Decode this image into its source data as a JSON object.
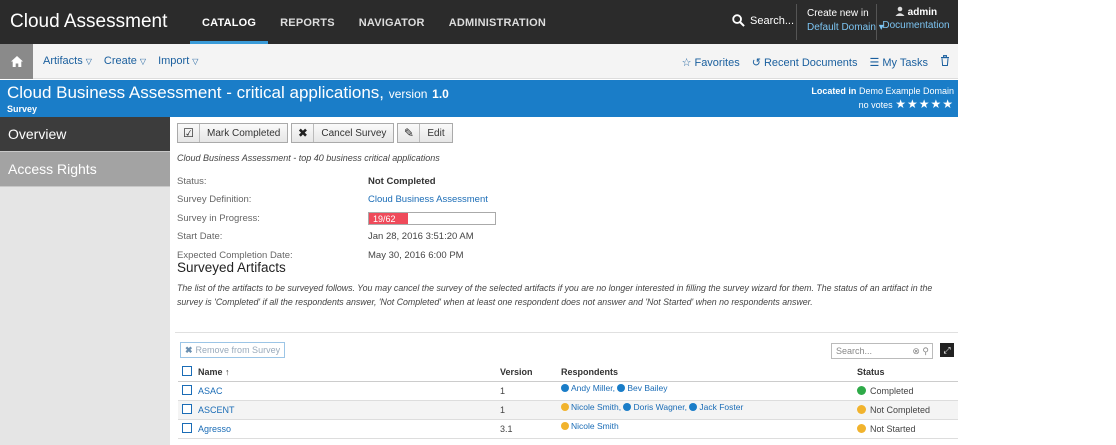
{
  "brand": "Cloud Assessment",
  "topnav": [
    {
      "label": "CATALOG",
      "active": true
    },
    {
      "label": "REPORTS",
      "active": false
    },
    {
      "label": "NAVIGATOR",
      "active": false
    },
    {
      "label": "ADMINISTRATION",
      "active": false
    }
  ],
  "top_search": "Search...",
  "create_new": {
    "label": "Create new in",
    "domain": "Default Domain"
  },
  "user": {
    "name": "admin",
    "documentation": "Documentation"
  },
  "submenu": [
    "Artifacts",
    "Create",
    "Import"
  ],
  "subright": [
    "Favorites",
    "Recent Documents",
    "My Tasks"
  ],
  "title": {
    "main": "Cloud Business Assessment - critical applications,",
    "version_label": "version",
    "version": "1.0",
    "type": "Survey",
    "located_label": "Located in",
    "located_domain": "Demo Example Domain",
    "votes": "no votes",
    "stars": "★★★★★"
  },
  "sidebar": [
    {
      "label": "Overview",
      "active": true
    },
    {
      "label": "Access Rights",
      "active": false
    }
  ],
  "toolbar": {
    "mark_completed": "Mark Completed",
    "cancel_survey": "Cancel Survey",
    "edit": "Edit"
  },
  "description": "Cloud Business Assessment - top 40 business critical applications",
  "properties": {
    "status_label": "Status:",
    "status_value": "Not Completed",
    "definition_label": "Survey Definition:",
    "definition_value": "Cloud Business Assessment",
    "progress_label": "Survey in Progress:",
    "progress_text": "19/62",
    "progress_fraction": 0.306,
    "start_label": "Start Date:",
    "start_value": "Jan 28, 2016 3:51:20 AM",
    "expected_label": "Expected Completion Date:",
    "expected_value": "May 30, 2016 6:00 PM"
  },
  "surveyed": {
    "title": "Surveyed Artifacts",
    "description": "The list of the artifacts to be surveyed follows. You may cancel the survey of the selected artifacts if you are no longer interested in filling the survey wizard for them. The status of an artifact in the survey is 'Completed' if all the respondents answer, 'Not Completed' when at least one respondent does not answer and 'Not Started' when no respondents answer.",
    "remove_button": "Remove from Survey",
    "search_placeholder": "Search...",
    "columns": {
      "name": "Name ↑",
      "version": "Version",
      "respondents": "Respondents",
      "status": "Status"
    },
    "rows": [
      {
        "name": "ASAC",
        "version": "1",
        "respondents": [
          {
            "n": "Andy Miller",
            "done": true
          },
          {
            "n": "Bev Bailey",
            "done": true
          }
        ],
        "status": "Completed",
        "status_color": "green"
      },
      {
        "name": "ASCENT",
        "version": "1",
        "respondents": [
          {
            "n": "Nicole Smith",
            "done": false
          },
          {
            "n": "Doris Wagner",
            "done": true
          },
          {
            "n": "Jack Foster",
            "done": true
          }
        ],
        "status": "Not Completed",
        "status_color": "yellow"
      },
      {
        "name": "Agresso",
        "version": "3.1",
        "respondents": [
          {
            "n": "Nicole Smith",
            "done": false
          }
        ],
        "status": "Not Started",
        "status_color": "yellow"
      }
    ]
  }
}
